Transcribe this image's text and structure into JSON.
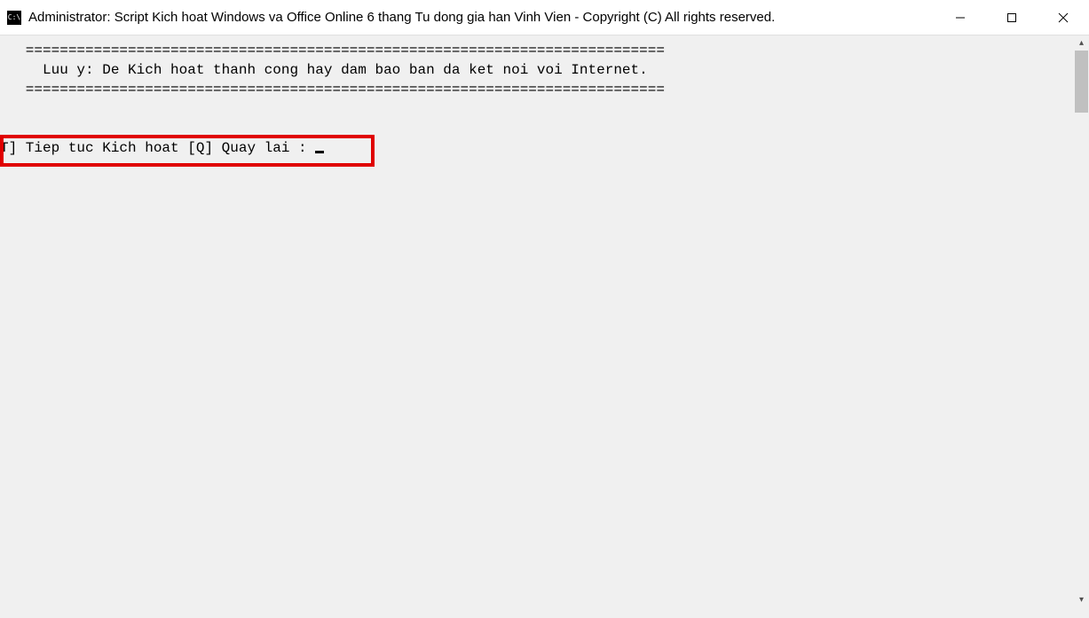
{
  "titlebar": {
    "icon_label": "C:\\",
    "title": "Administrator:  Script Kich hoat Windows va Office Online 6 thang Tu dong gia han Vinh Vien - Copyright (C) All rights reserved."
  },
  "console": {
    "separator": "   ===========================================================================",
    "notice": "     Luu y: De Kich hoat thanh cong hay dam bao ban da ket noi voi Internet.",
    "prompt": "T] Tiep tuc Kich hoat [Q] Quay lai : "
  },
  "window_controls": {
    "minimize": "minimize",
    "maximize": "maximize",
    "close": "close"
  }
}
